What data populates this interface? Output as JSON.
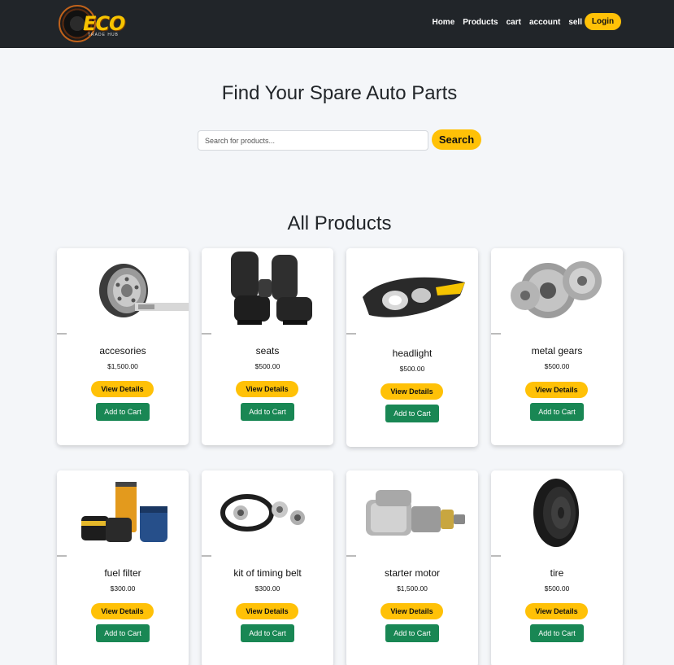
{
  "brand": {
    "name": "ECO",
    "tagline": "TRADE HUB"
  },
  "nav": {
    "links": [
      "Home",
      "Products",
      "cart",
      "account",
      "sell"
    ],
    "login_label": "Login"
  },
  "hero": {
    "title": "Find Your Spare Auto Parts"
  },
  "search": {
    "placeholder": "Search for products...",
    "value": "",
    "button_label": "Search"
  },
  "products_section": {
    "title": "All Products"
  },
  "buttons": {
    "view_details": "View Details",
    "add_to_cart": "Add to Cart"
  },
  "products": [
    {
      "name": "accesories",
      "price": "$1,500.00",
      "icon": "steel-wheel-rim-icon"
    },
    {
      "name": "seats",
      "price": "$500.00",
      "icon": "car-seats-icon"
    },
    {
      "name": "headlight",
      "price": "$500.00",
      "icon": "headlight-icon"
    },
    {
      "name": "metal gears",
      "price": "$500.00",
      "icon": "metal-gears-icon"
    },
    {
      "name": "fuel filter",
      "price": "$300.00",
      "icon": "fuel-filter-icon"
    },
    {
      "name": "kit of timing belt",
      "price": "$300.00",
      "icon": "timing-belt-kit-icon"
    },
    {
      "name": "starter motor",
      "price": "$1,500.00",
      "icon": "starter-motor-icon"
    },
    {
      "name": "tire",
      "price": "$500.00",
      "icon": "tire-icon"
    }
  ],
  "colors": {
    "navbar": "#212529",
    "accent": "#ffc107",
    "cart_button": "#198754",
    "page_bg": "#f4f6f9"
  }
}
